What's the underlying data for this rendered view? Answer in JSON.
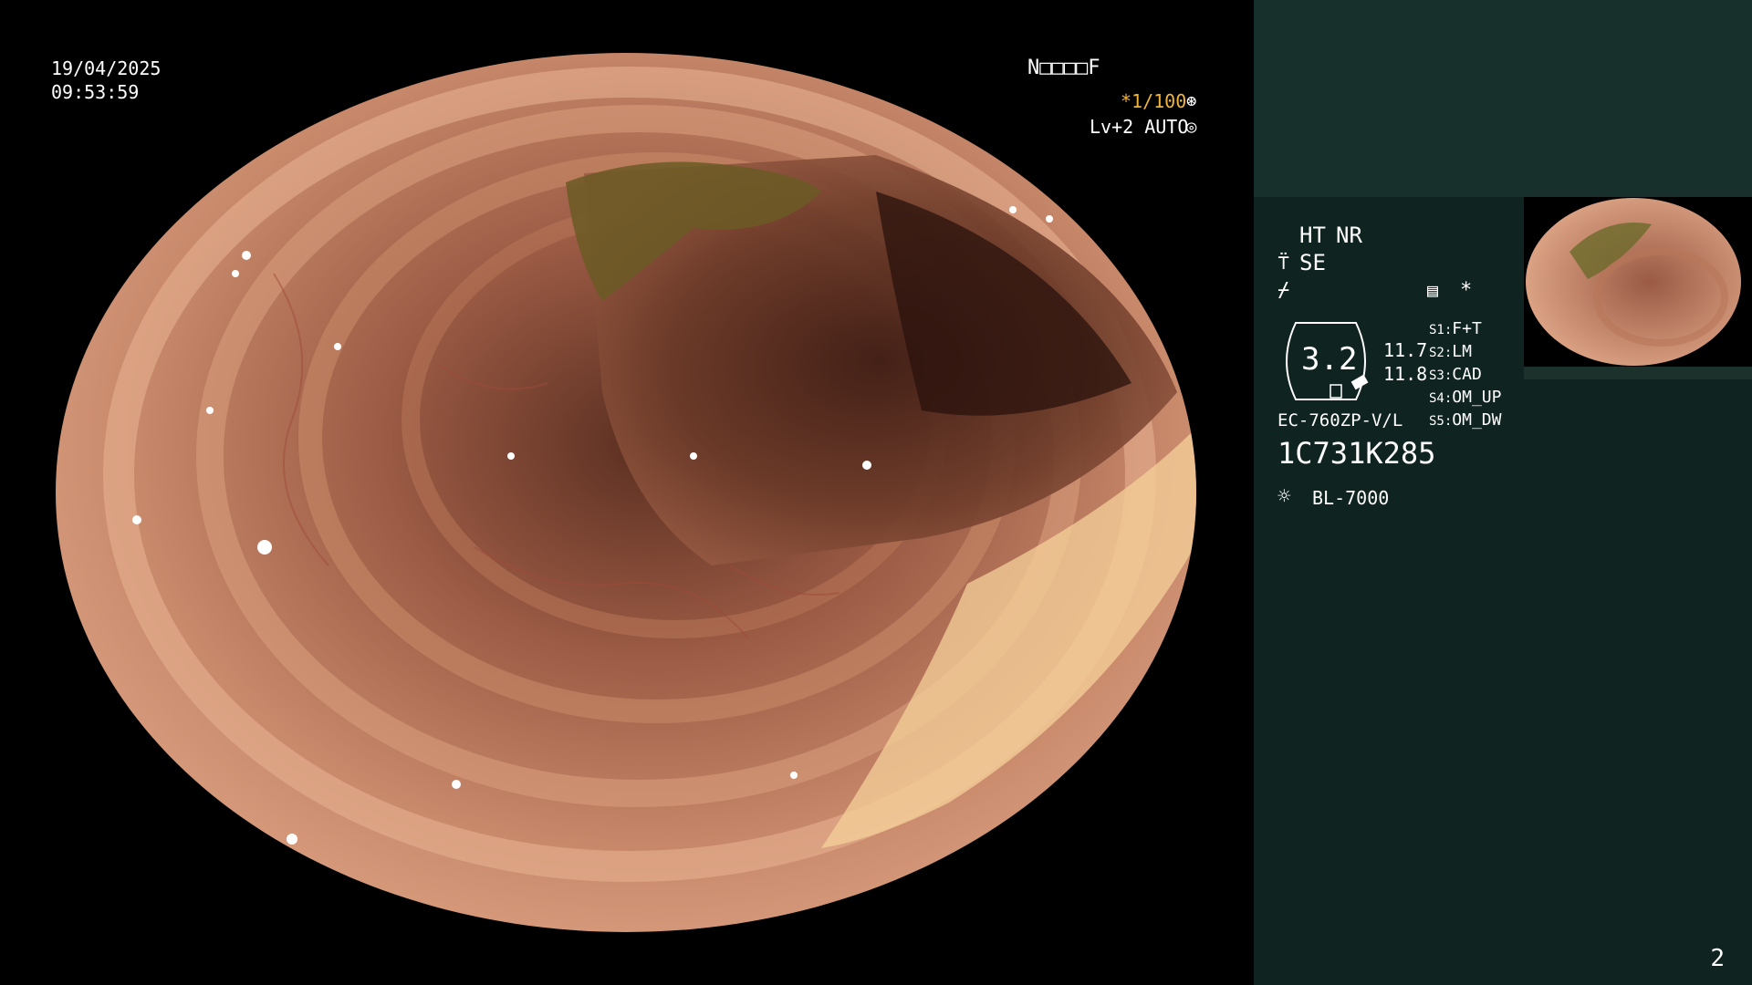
{
  "overlay": {
    "date": "19/04/2025",
    "time": "09:53:59",
    "patient_id": "N□□□□F",
    "shutter": "*1/100",
    "level": "Lv+2 AUTO"
  },
  "sidebar": {
    "ht_label": "HT",
    "nr_label": "NR",
    "se_label": "SE",
    "star": "*",
    "pill_value": "3.2",
    "value_a": "11.7",
    "value_b": "11.8",
    "presets": [
      {
        "key": "S1:",
        "val": "F+T"
      },
      {
        "key": "S2:",
        "val": "LM"
      },
      {
        "key": "S3:",
        "val": "CAD"
      },
      {
        "key": "S4:",
        "val": "OM_UP"
      },
      {
        "key": "S5:",
        "val": "OM_DW"
      }
    ],
    "scope_model": "EC-760ZP-V/L",
    "serial": "1C731K285",
    "light_source": "BL-7000"
  },
  "page_number": "2",
  "colors": {
    "accent": "#f0b43c",
    "sidebar_bg": "#0f2320",
    "sidebar_top": "#17302c"
  }
}
